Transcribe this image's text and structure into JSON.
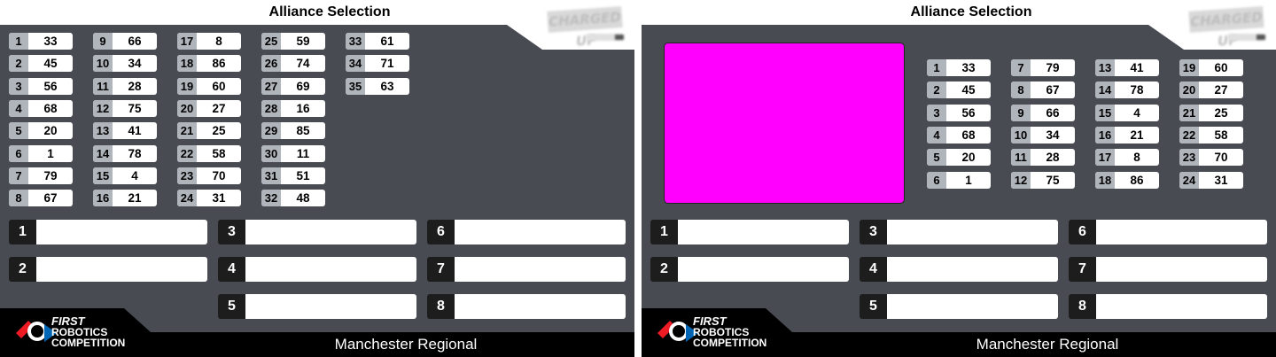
{
  "title": "Alliance Selection",
  "event_name": "Manchester Regional",
  "brand": {
    "first_line1": "FIRST",
    "first_line2": "ROBOTICS",
    "first_line3": "COMPETITION",
    "game_logo_icon": "charged-up-logo-icon",
    "first_logo_icon": "first-logo-icon"
  },
  "colors": {
    "panel_bg": "#484b52",
    "rank_bg": "#b0b5bc",
    "video_placeholder": "#ff00ff",
    "footer": "#000000"
  },
  "left_panel": {
    "seeds": [
      {
        "rank": "1",
        "team": "33"
      },
      {
        "rank": "2",
        "team": "45"
      },
      {
        "rank": "3",
        "team": "56"
      },
      {
        "rank": "4",
        "team": "68"
      },
      {
        "rank": "5",
        "team": "20"
      },
      {
        "rank": "6",
        "team": "1"
      },
      {
        "rank": "7",
        "team": "79"
      },
      {
        "rank": "8",
        "team": "67"
      },
      {
        "rank": "9",
        "team": "66"
      },
      {
        "rank": "10",
        "team": "34"
      },
      {
        "rank": "11",
        "team": "28"
      },
      {
        "rank": "12",
        "team": "75"
      },
      {
        "rank": "13",
        "team": "41"
      },
      {
        "rank": "14",
        "team": "78"
      },
      {
        "rank": "15",
        "team": "4"
      },
      {
        "rank": "16",
        "team": "21"
      },
      {
        "rank": "17",
        "team": "8"
      },
      {
        "rank": "18",
        "team": "86"
      },
      {
        "rank": "19",
        "team": "60"
      },
      {
        "rank": "20",
        "team": "27"
      },
      {
        "rank": "21",
        "team": "25"
      },
      {
        "rank": "22",
        "team": "58"
      },
      {
        "rank": "23",
        "team": "70"
      },
      {
        "rank": "24",
        "team": "31"
      },
      {
        "rank": "25",
        "team": "59"
      },
      {
        "rank": "26",
        "team": "74"
      },
      {
        "rank": "27",
        "team": "69"
      },
      {
        "rank": "28",
        "team": "16"
      },
      {
        "rank": "29",
        "team": "85"
      },
      {
        "rank": "30",
        "team": "11"
      },
      {
        "rank": "31",
        "team": "51"
      },
      {
        "rank": "32",
        "team": "48"
      },
      {
        "rank": "33",
        "team": "61"
      },
      {
        "rank": "34",
        "team": "71"
      },
      {
        "rank": "35",
        "team": "63"
      }
    ],
    "alliances": [
      {
        "number": "1",
        "teams": ""
      },
      {
        "number": "2",
        "teams": ""
      },
      {
        "number": "3",
        "teams": ""
      },
      {
        "number": "4",
        "teams": ""
      },
      {
        "number": "5",
        "teams": ""
      },
      {
        "number": "6",
        "teams": ""
      },
      {
        "number": "7",
        "teams": ""
      },
      {
        "number": "8",
        "teams": ""
      }
    ]
  },
  "right_panel": {
    "seeds": [
      {
        "rank": "1",
        "team": "33"
      },
      {
        "rank": "2",
        "team": "45"
      },
      {
        "rank": "3",
        "team": "56"
      },
      {
        "rank": "4",
        "team": "68"
      },
      {
        "rank": "5",
        "team": "20"
      },
      {
        "rank": "6",
        "team": "1"
      },
      {
        "rank": "7",
        "team": "79"
      },
      {
        "rank": "8",
        "team": "67"
      },
      {
        "rank": "9",
        "team": "66"
      },
      {
        "rank": "10",
        "team": "34"
      },
      {
        "rank": "11",
        "team": "28"
      },
      {
        "rank": "12",
        "team": "75"
      },
      {
        "rank": "13",
        "team": "41"
      },
      {
        "rank": "14",
        "team": "78"
      },
      {
        "rank": "15",
        "team": "4"
      },
      {
        "rank": "16",
        "team": "21"
      },
      {
        "rank": "17",
        "team": "8"
      },
      {
        "rank": "18",
        "team": "86"
      },
      {
        "rank": "19",
        "team": "60"
      },
      {
        "rank": "20",
        "team": "27"
      },
      {
        "rank": "21",
        "team": "25"
      },
      {
        "rank": "22",
        "team": "58"
      },
      {
        "rank": "23",
        "team": "70"
      },
      {
        "rank": "24",
        "team": "31"
      }
    ],
    "alliances": [
      {
        "number": "1",
        "teams": ""
      },
      {
        "number": "2",
        "teams": ""
      },
      {
        "number": "3",
        "teams": ""
      },
      {
        "number": "4",
        "teams": ""
      },
      {
        "number": "5",
        "teams": ""
      },
      {
        "number": "6",
        "teams": ""
      },
      {
        "number": "7",
        "teams": ""
      },
      {
        "number": "8",
        "teams": ""
      }
    ]
  }
}
